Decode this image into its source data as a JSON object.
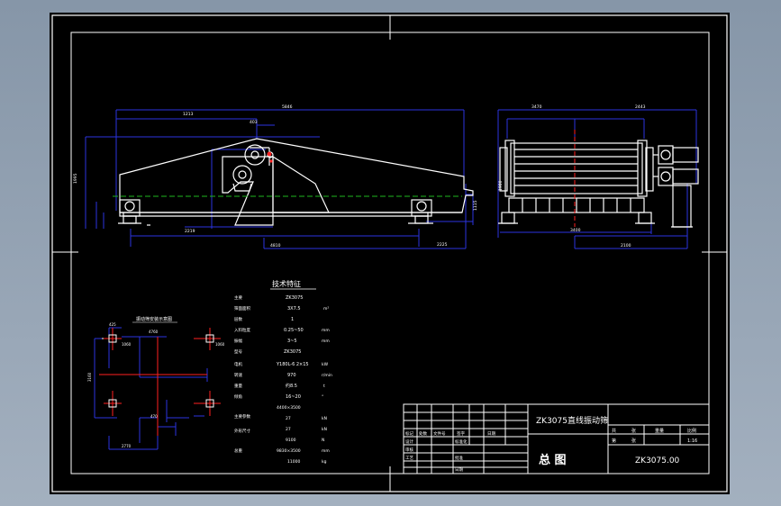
{
  "title_block": {
    "machine_name": "ZK3075直线振动筛",
    "drawing_name": "总 图",
    "drawing_number": "ZK3075.00",
    "scale": "1:16",
    "row_labels": [
      "标记",
      "处数",
      "文件号",
      "签字",
      "日期"
    ],
    "sign_labels": [
      "设计",
      "标准化",
      "审核",
      "工艺",
      "批准",
      "日期"
    ],
    "right_labels": [
      "共",
      "张",
      "重量",
      "比例",
      "第",
      "张"
    ]
  },
  "tech_specs": {
    "heading": "技术特征",
    "values": [
      "ZK3075",
      "3X7.5",
      "1",
      "0.25~50",
      "3~5",
      "ZK3075",
      "Y180L-6 2×15",
      "970",
      "约8.5",
      "16~20"
    ]
  },
  "plan_view": {
    "title": "振动筛安装示意图"
  },
  "palette": {
    "background": "#000000",
    "frame": "#ffffff",
    "dimension": "#2b35e0",
    "centerline": "#1fb81f",
    "accent": "#ff2020"
  }
}
